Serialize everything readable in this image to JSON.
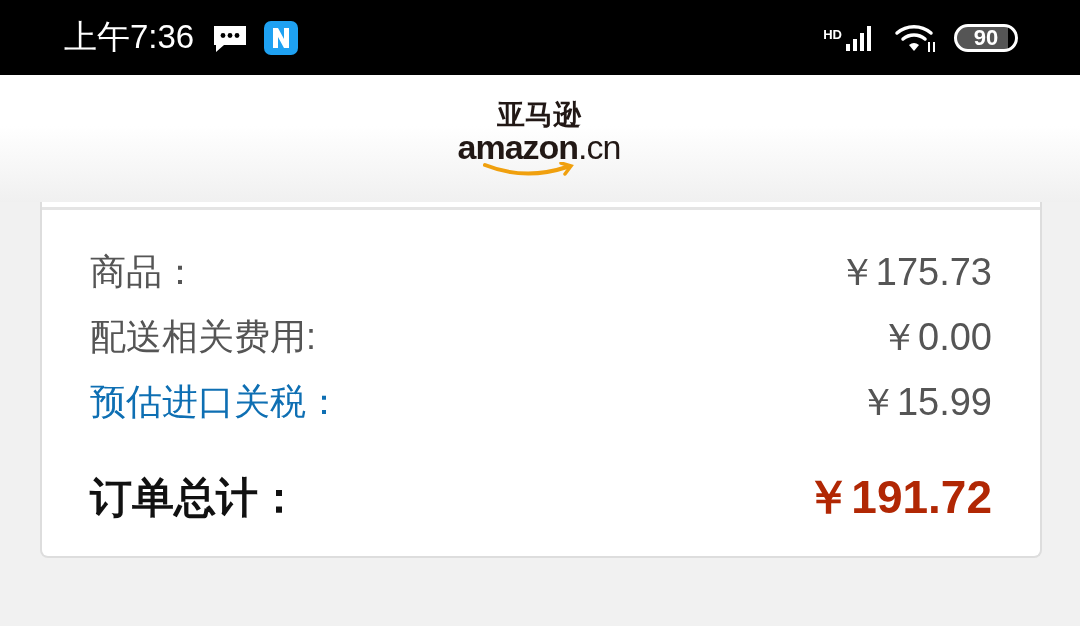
{
  "status_bar": {
    "time": "上午7:36",
    "network": "HD",
    "battery": "90"
  },
  "header": {
    "logo_cn": "亚马逊",
    "logo_word": "amazon",
    "logo_suffix": ".cn"
  },
  "summary": {
    "rows": [
      {
        "kind": "plain",
        "label": "商品：",
        "amount": "￥175.73"
      },
      {
        "kind": "plain",
        "label": "配送相关费用:",
        "amount": "￥0.00"
      },
      {
        "kind": "link",
        "label": "预估进口关税：",
        "amount": "￥15.99"
      },
      {
        "kind": "total",
        "label": "订单总计：",
        "amount": "￥191.72"
      }
    ]
  }
}
